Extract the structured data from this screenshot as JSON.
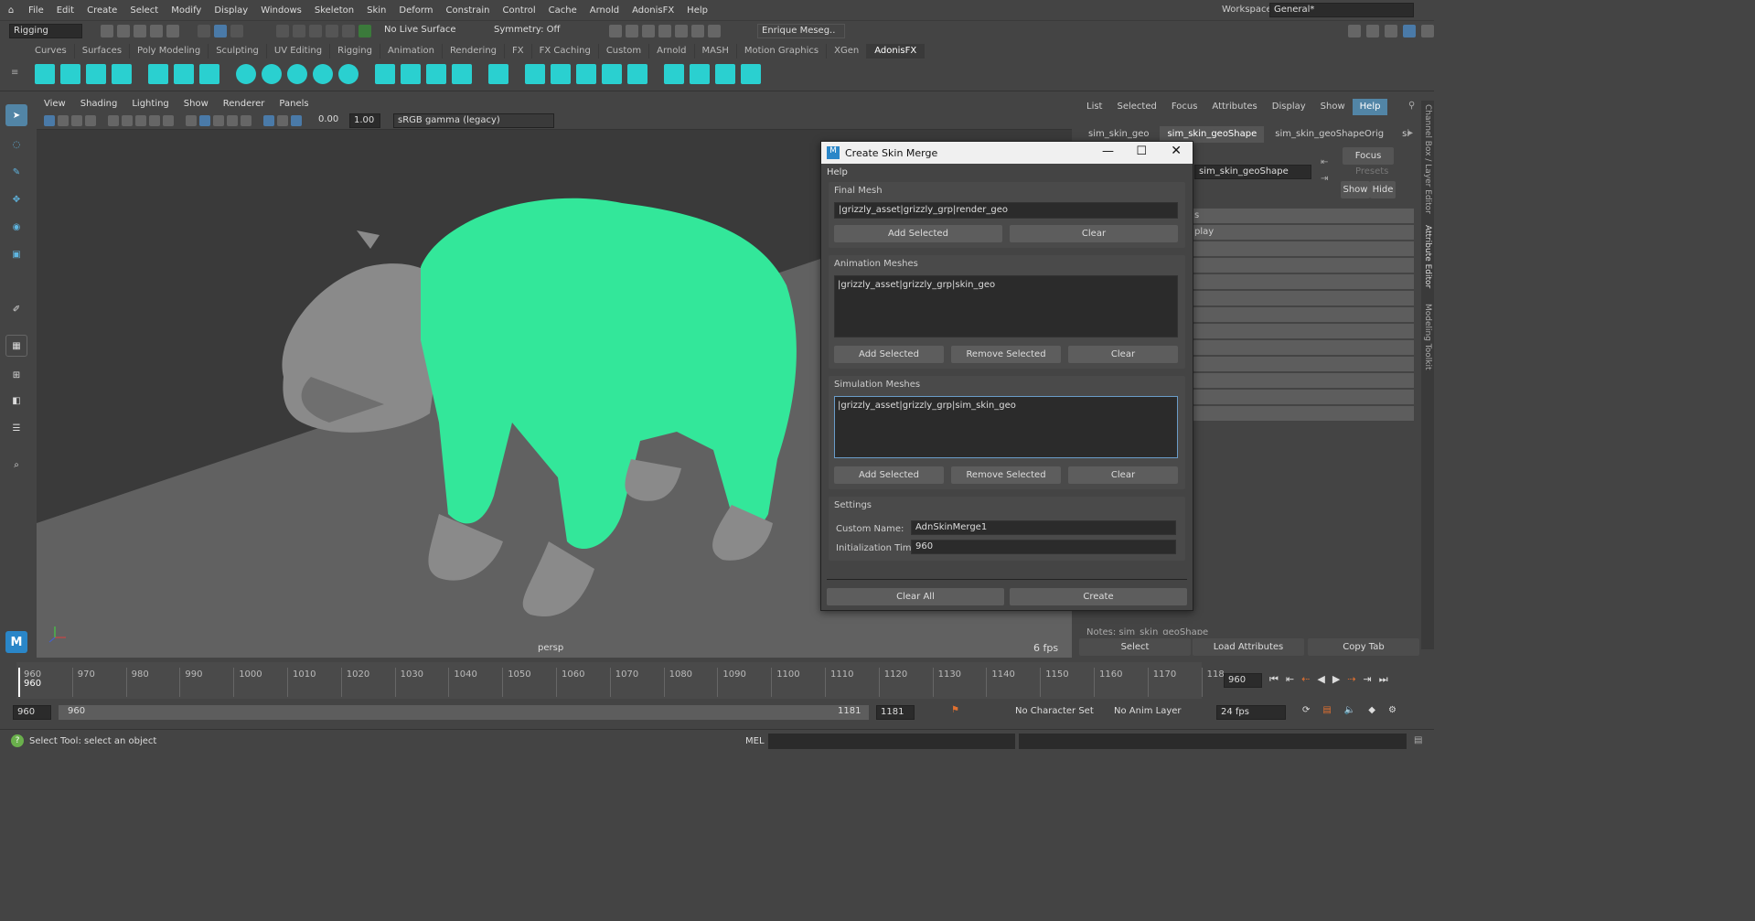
{
  "menubar": {
    "items": [
      "File",
      "Edit",
      "Create",
      "Select",
      "Modify",
      "Display",
      "Windows",
      "Skeleton",
      "Skin",
      "Deform",
      "Constrain",
      "Control",
      "Cache",
      "Arnold",
      "AdonisFX",
      "Help"
    ],
    "workspace_label": "Workspace:",
    "workspace_value": "General*"
  },
  "statusline": {
    "mode": "Rigging",
    "live_surface": "No Live Surface",
    "symmetry": "Symmetry: Off",
    "user": "Enrique Meseg.."
  },
  "shelf": {
    "tabs": [
      "Curves",
      "Surfaces",
      "Poly Modeling",
      "Sculpting",
      "UV Editing",
      "Rigging",
      "Animation",
      "Rendering",
      "FX",
      "FX Caching",
      "Custom",
      "Arnold",
      "MASH",
      "Motion Graphics",
      "XGen",
      "AdonisFX"
    ],
    "active": "AdonisFX"
  },
  "viewport": {
    "menu": [
      "View",
      "Shading",
      "Lighting",
      "Show",
      "Renderer",
      "Panels"
    ],
    "near": "0.00",
    "far": "1.00",
    "color_space": "sRGB gamma (legacy)",
    "camera": "persp",
    "fps": "6 fps"
  },
  "rightpanel": {
    "menu": [
      "List",
      "Selected",
      "Focus",
      "Attributes",
      "Display",
      "Show",
      "Help"
    ],
    "tabs": [
      "sim_skin_geo",
      "sim_skin_geoShape",
      "sim_skin_geoShapeOrig",
      "sim_skin"
    ],
    "node_name": "sim_skin_geoShape",
    "focus": "Focus",
    "presets": "Presets",
    "show": "Show",
    "hide": "Hide",
    "row1": "s",
    "row2": "play",
    "notes": "Notes: sim_skin_geoShape",
    "select": "Select",
    "load_attributes": "Load Attributes",
    "copy_tab": "Copy Tab",
    "side_tabs": [
      "Channel Box / Layer Editor",
      "Attribute Editor",
      "Modeling Toolkit"
    ]
  },
  "dialog": {
    "title": "Create Skin Merge",
    "menu_help": "Help",
    "final_mesh": {
      "label": "Final Mesh",
      "value": "|grizzly_asset|grizzly_grp|render_geo",
      "add": "Add Selected",
      "clear": "Clear"
    },
    "animation": {
      "label": "Animation Meshes",
      "value": "|grizzly_asset|grizzly_grp|skin_geo",
      "add": "Add Selected",
      "remove": "Remove Selected",
      "clear": "Clear"
    },
    "simulation": {
      "label": "Simulation Meshes",
      "value": "|grizzly_asset|grizzly_grp|sim_skin_geo",
      "add": "Add Selected",
      "remove": "Remove Selected",
      "clear": "Clear"
    },
    "settings": {
      "label": "Settings",
      "custom_name_label": "Custom Name:",
      "custom_name": "AdnSkinMerge1",
      "init_time_label": "Initialization Time:",
      "init_time": "960"
    },
    "clear_all": "Clear All",
    "create": "Create"
  },
  "timeline": {
    "ticks": [
      "960",
      "970",
      "980",
      "990",
      "1000",
      "1010",
      "1020",
      "1030",
      "1040",
      "1050",
      "1060",
      "1070",
      "1080",
      "1090",
      "1100",
      "1110",
      "1120",
      "1130",
      "1140",
      "1150",
      "1160",
      "1170",
      "118"
    ],
    "current": "960",
    "current_field": "960"
  },
  "range": {
    "start": "960",
    "inner_start": "960",
    "inner_end": "1181",
    "end": "1181",
    "character_set": "No Character Set",
    "anim_layer": "No Anim Layer",
    "fps": "24 fps"
  },
  "cmd": {
    "help": "Select Tool: select an object",
    "lang": "MEL"
  }
}
